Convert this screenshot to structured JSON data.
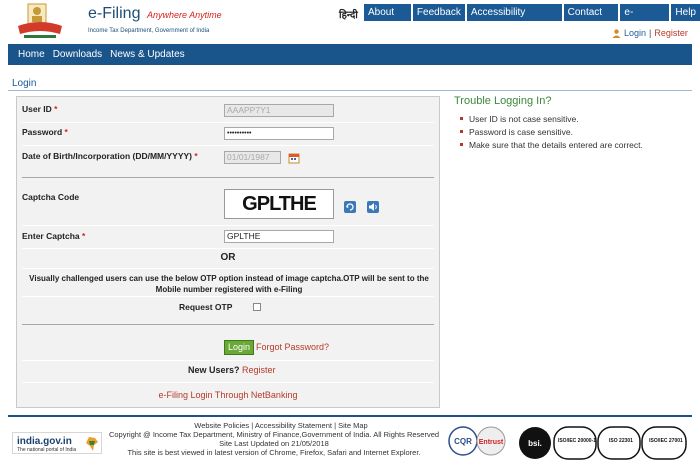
{
  "brand": {
    "title": "e-Filing",
    "tagline": "Anywhere Anytime",
    "subtitle": "Income Tax Department, Government of India"
  },
  "header": {
    "hindi": "हिन्दी",
    "nav": [
      "About Us",
      "Feedback",
      "Accessibility Options",
      "Contact Us",
      "e-Nivaran",
      "Help"
    ],
    "login": "Login",
    "separator": "|",
    "register": "Register"
  },
  "mainnav": [
    "Home",
    "Downloads",
    "News & Updates"
  ],
  "login": {
    "title": "Login",
    "user_id_label": "User ID",
    "user_id_value": "AAAPP7Y1",
    "password_label": "Password",
    "password_value": "••••••••••",
    "dob_label": "Date of Birth/Incorporation (DD/MM/YYYY)",
    "dob_value": "01/01/1987",
    "required_mark": "*",
    "captcha_label": "Captcha Code",
    "captcha_text": "GPLTHE",
    "enter_captcha_label": "Enter Captcha",
    "enter_captcha_value": "GPLTHE",
    "or": "OR",
    "visually_note": "Visually challenged users can use the below OTP option instead of image captcha.OTP will be sent to the Mobile number registered with e-Filing",
    "request_otp_label": "Request OTP",
    "login_button": "Login",
    "forgot_password": "Forgot Password?",
    "new_users": "New Users?",
    "register": "Register",
    "netbanking": "e-Filing Login Through NetBanking"
  },
  "trouble": {
    "title": "Trouble Logging In?",
    "items": [
      "User ID is not case sensitive.",
      "Password is case sensitive.",
      "Make sure that the details entered are correct."
    ]
  },
  "footer": {
    "links": [
      "Website Policies",
      "Accessibility Statement",
      "Site Map"
    ],
    "separator": "|",
    "copyright": "Copyright @ Income Tax Department, Ministry of Finance,Government of India. All Rights Reserved",
    "last_updated": "Site Last Updated on 21/05/2018",
    "best_viewed": "This site is best viewed in latest version of Chrome, Firefox, Safari and Internet Explorer.",
    "indiagov_title": "india.gov.in",
    "indiagov_sub": "The national portal of India",
    "certs": [
      "CQR",
      "Entrust",
      "bsi.",
      "ISO/IEC 20000-1",
      "ISO 22301",
      "ISO/IEC 27001"
    ]
  },
  "colors": {
    "nav_blue": "#19558b",
    "accent_red": "#b53a2a",
    "trouble_green": "#3a8a3a",
    "login_green": "#6aa936"
  }
}
